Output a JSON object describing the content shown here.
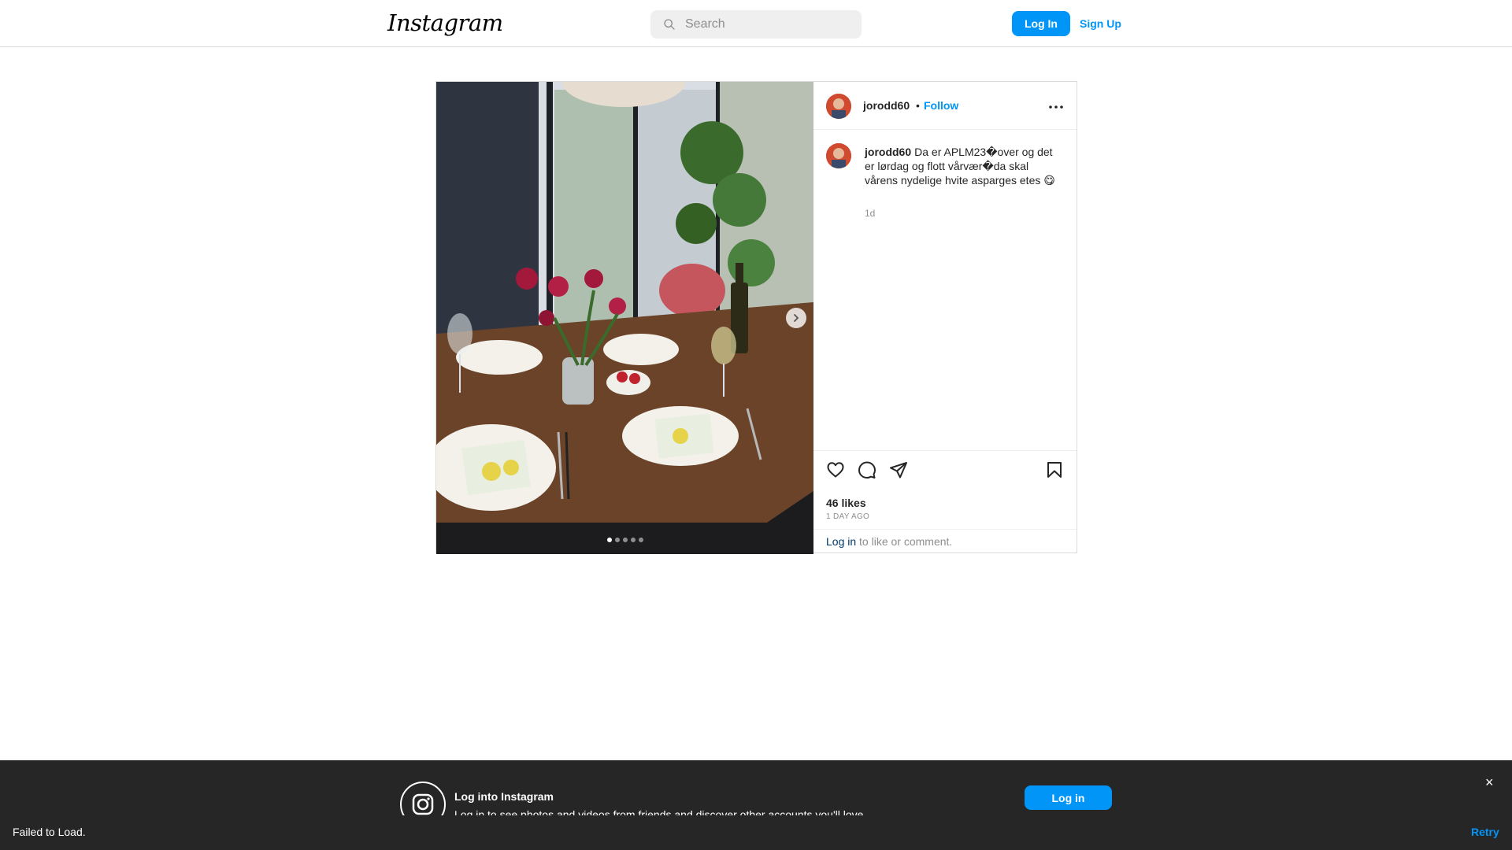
{
  "nav": {
    "logo": "Instagram",
    "search_placeholder": "Search",
    "login_label": "Log In",
    "signup_label": "Sign Up"
  },
  "post": {
    "username": "jorodd60",
    "follow_label": "Follow",
    "bullet": "•",
    "caption_username": "jorodd60",
    "caption_text": "Da er APLM23�over og det er lørdag og flott vårvær�da skal vårens nydelige hvite asparges etes 😋",
    "caption_time": "1d",
    "likes": "46 likes",
    "date": "1 DAY AGO",
    "login_link": "Log in",
    "login_suffix": " to like or comment.",
    "carousel_count": 5,
    "carousel_active": 0,
    "icons": [
      "heart-icon",
      "comment-icon",
      "share-icon",
      "bookmark-icon",
      "more-icon",
      "chevron-right-icon"
    ]
  },
  "banner": {
    "title": "Log into Instagram",
    "subtitle": "Log in to see photos and videos from friends and discover other accounts you'll love.",
    "login_label": "Log in",
    "close": "×"
  },
  "error": {
    "message": "Failed to Load.",
    "retry_label": "Retry"
  },
  "colors": {
    "accent": "#0095f6",
    "banner_bg": "#262626"
  }
}
